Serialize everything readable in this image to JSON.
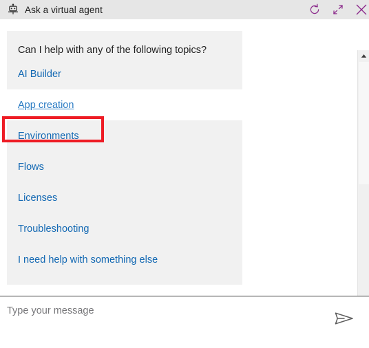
{
  "window": {
    "title": "Ask a virtual agent",
    "icon": "bot-icon",
    "titlebar_background": "#e6e6e6",
    "actions": [
      {
        "name": "refresh-icon",
        "label": "Restart conversation",
        "color": "#8b2a8b"
      },
      {
        "name": "minimize-icon",
        "label": "Minimize",
        "color": "#8b2a8b"
      },
      {
        "name": "close-icon",
        "label": "Close",
        "color": "#8b2a8b"
      }
    ]
  },
  "conversation": {
    "bubble_background": "#f1f1f1",
    "message": {
      "question": "Can I help with any of the following topics?",
      "topics": [
        {
          "label": "AI Builder",
          "hovered": false
        },
        {
          "label": "App creation",
          "hovered": true
        },
        {
          "label": "Environments",
          "hovered": false
        },
        {
          "label": "Flows",
          "hovered": false
        },
        {
          "label": "Licenses",
          "hovered": false
        },
        {
          "label": "Troubleshooting",
          "hovered": false
        },
        {
          "label": "I need help with something else",
          "hovered": false
        }
      ]
    },
    "link_color": "#1268b3",
    "annotation": {
      "target": "App creation",
      "color": "#ee1c25",
      "shape": "rectangle"
    }
  },
  "scrollbar": {
    "up_arrow": "scroll-up-arrow-icon",
    "orientation": "vertical"
  },
  "composer": {
    "placeholder": "Type your message",
    "value": "",
    "send_icon": "send-paper-plane-icon"
  }
}
